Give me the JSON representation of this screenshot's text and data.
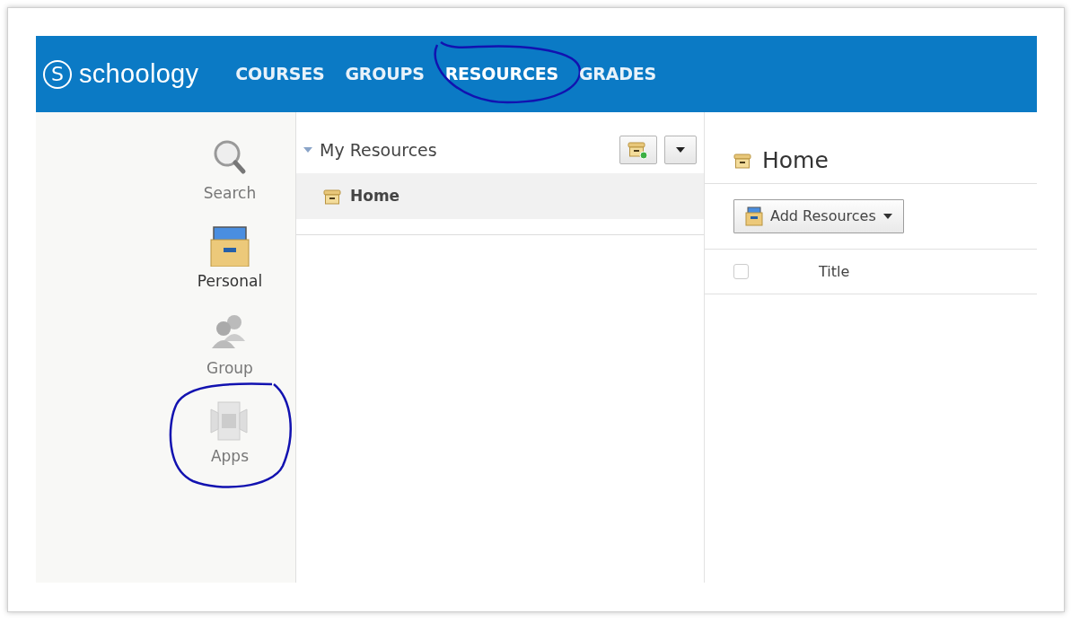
{
  "logo": {
    "mark": "S",
    "text": "schoology"
  },
  "nav": [
    {
      "label": "COURSES",
      "selected": false,
      "circled": false
    },
    {
      "label": "GROUPS",
      "selected": false,
      "circled": false
    },
    {
      "label": "RESOURCES",
      "selected": true,
      "circled": true
    },
    {
      "label": "GRADES",
      "selected": false,
      "circled": false
    }
  ],
  "sidebar": {
    "items": [
      {
        "kind": "search",
        "label": "Search",
        "selected": false,
        "circled": false
      },
      {
        "kind": "personal",
        "label": "Personal",
        "selected": true,
        "circled": false
      },
      {
        "kind": "group",
        "label": "Group",
        "selected": false,
        "circled": false
      },
      {
        "kind": "apps",
        "label": "Apps",
        "selected": false,
        "circled": true
      }
    ]
  },
  "tree": {
    "title": "My Resources",
    "expanded": true,
    "items": [
      {
        "label": "Home",
        "selected": true
      }
    ]
  },
  "main": {
    "title": "Home",
    "add_button": "Add Resources",
    "columns": [
      {
        "label": "Title"
      }
    ],
    "select_all_checked": false
  }
}
